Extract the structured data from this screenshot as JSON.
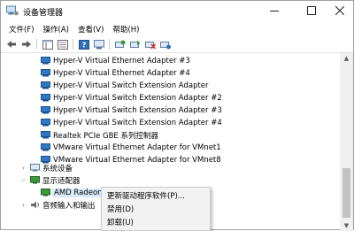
{
  "window": {
    "title": "设备管理器"
  },
  "menubar": {
    "items": [
      "文件(F)",
      "操作(A)",
      "查看(V)",
      "帮助(H)"
    ]
  },
  "toolbar": {
    "buttons": [
      "back-icon",
      "forward-icon",
      "tree-view-icon",
      "properties-icon",
      "help-icon",
      "computer-icon",
      "scan-hardware-icon",
      "update-driver-icon",
      "disable-device-icon",
      "uninstall-device-icon"
    ]
  },
  "tree": {
    "devices": [
      "Hyper-V Virtual Ethernet Adapter #3",
      "Hyper-V Virtual Ethernet Adapter #4",
      "Hyper-V Virtual Switch Extension Adapter",
      "Hyper-V Virtual Switch Extension Adapter #2",
      "Hyper-V Virtual Switch Extension Adapter #3",
      "Hyper-V Virtual Switch Extension Adapter #4",
      "Realtek PCIe GBE 系列控制器",
      "VMware Virtual Ethernet Adapter for VMnet1",
      "VMware Virtual Ethernet Adapter for VMnet8"
    ],
    "system_devices": "系统设备",
    "display_adapters": "显示适配器",
    "amd_device": "AMD Radeon HI",
    "audio_io": "音频输入和输出"
  },
  "context_menu": {
    "update_driver": "更新驱动程序软件(P)...",
    "disable": "禁用(D)",
    "uninstall": "卸载(U)"
  },
  "colors": {
    "network_icon": "#2f78c4",
    "selection": "#d9ebf9",
    "menu_bg": "#f2f2f2"
  }
}
